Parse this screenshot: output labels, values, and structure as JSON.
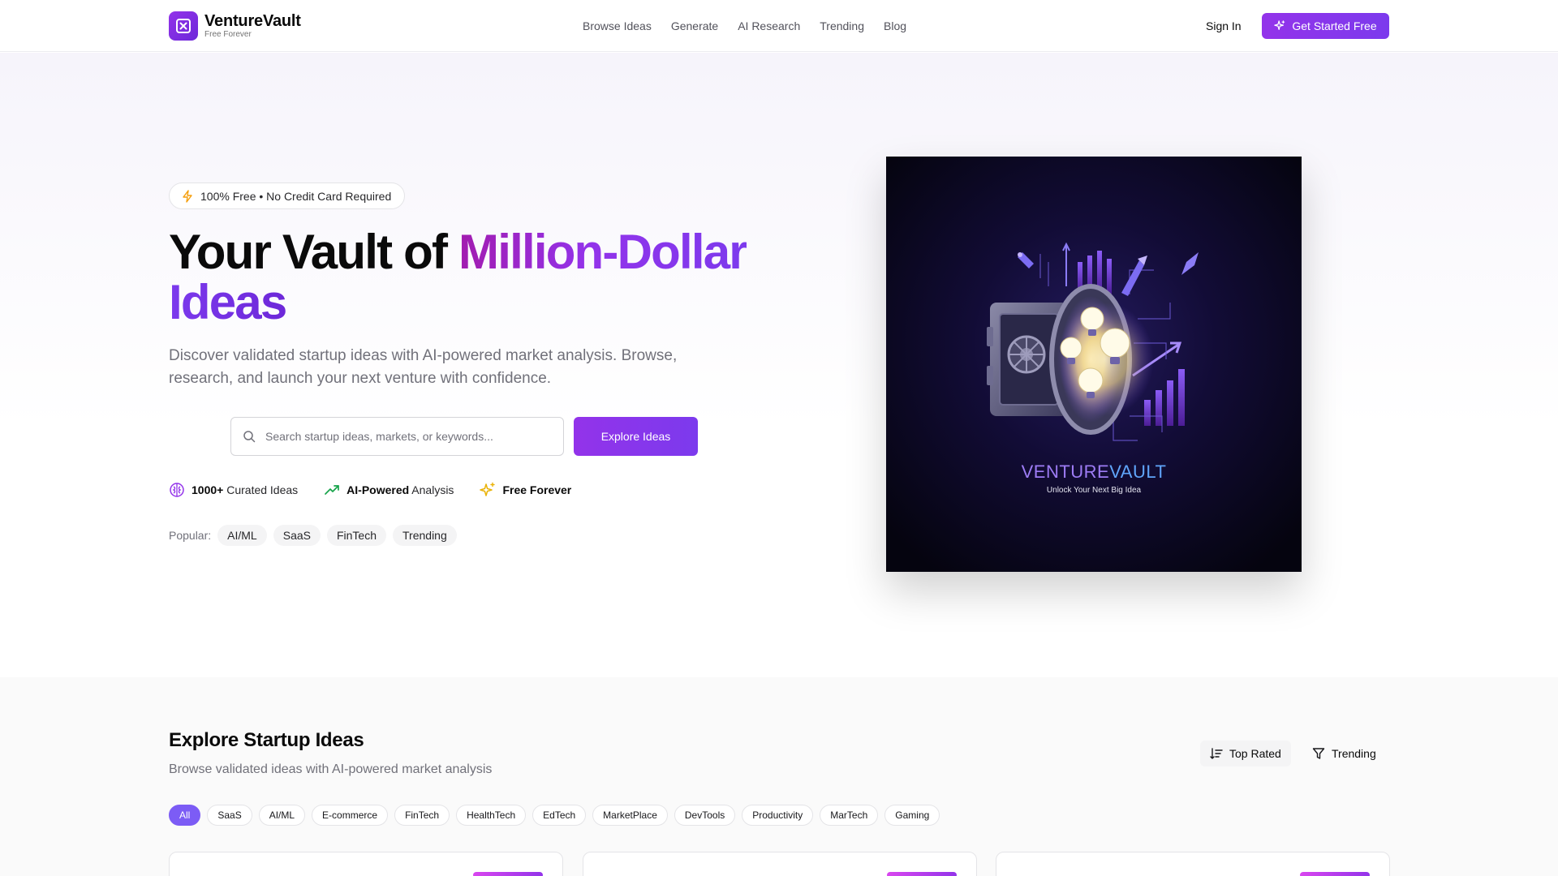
{
  "header": {
    "logo_name": "VentureVault",
    "logo_sub": "Free Forever",
    "nav": [
      "Browse Ideas",
      "Generate",
      "AI Research",
      "Trending",
      "Blog"
    ],
    "sign_in": "Sign In",
    "cta": "Get Started Free"
  },
  "hero": {
    "badge": "100% Free • No Credit Card Required",
    "headline_part1": "Your Vault of ",
    "headline_part2": "Million-Dollar",
    "headline_part3": "Ideas",
    "subtext": "Discover validated startup ideas with AI-powered market analysis. Browse, research, and launch your next venture with confidence.",
    "search_placeholder": "Search startup ideas, markets, or keywords...",
    "explore_button": "Explore Ideas",
    "features": [
      {
        "bold": "1000+",
        "text": " Curated Ideas",
        "icon": "brain-icon"
      },
      {
        "bold": "AI-Powered",
        "text": " Analysis",
        "icon": "trending-up-icon"
      },
      {
        "bold": "Free Forever",
        "text": "",
        "icon": "sparkles-icon"
      }
    ],
    "popular_label": "Popular:",
    "popular": [
      "AI/ML",
      "SaaS",
      "FinTech",
      "Trending"
    ],
    "image_title_a": "VENTURE",
    "image_title_b": "VAULT",
    "image_tagline": "Unlock Your Next Big Idea"
  },
  "explore": {
    "title": "Explore Startup Ideas",
    "subtitle": "Browse validated ideas with AI-powered market analysis",
    "sort_top": "Top Rated",
    "sort_trending": "Trending",
    "categories": [
      "All",
      "SaaS",
      "AI/ML",
      "E-commerce",
      "FinTech",
      "HealthTech",
      "EdTech",
      "MarketPlace",
      "DevTools",
      "Productivity",
      "MarTech",
      "Gaming"
    ]
  },
  "colors": {
    "accent": "#7c3aed",
    "accent_pink": "#a21caf",
    "active_chip": "#7c5cf5"
  }
}
